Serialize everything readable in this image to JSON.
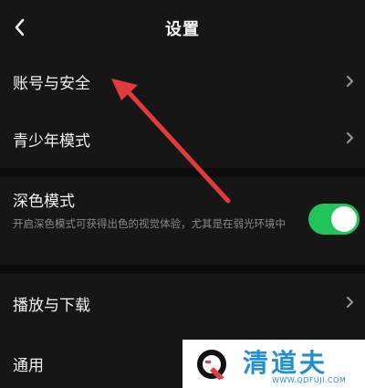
{
  "header": {
    "title": "设置"
  },
  "items": [
    {
      "label": "账号与安全"
    },
    {
      "label": "青少年模式"
    },
    {
      "label": "深色模式",
      "description": "开启深色模式可获得出色的视觉体验，尤其是在弱光环境中",
      "toggle_on": true
    },
    {
      "label": "播放与下载"
    },
    {
      "label": "通用"
    }
  ],
  "watermark": {
    "text": "清道夫",
    "url": "WWW.QDFUJI.COM"
  },
  "colors": {
    "background": "#161616",
    "toggle_on": "#21c45a",
    "arrow": "#e03c3c",
    "watermark": "#1f8fd4"
  }
}
